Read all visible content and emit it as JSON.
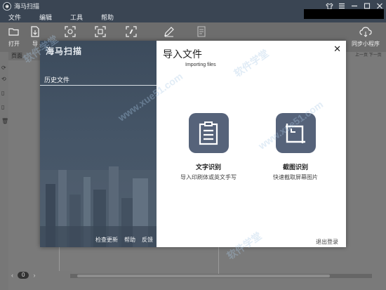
{
  "window": {
    "title": "海马扫描",
    "controls": [
      "shirt-icon",
      "menu-icon",
      "minimize-icon",
      "maximize-icon",
      "close-icon"
    ]
  },
  "menu": [
    "文件",
    "编辑",
    "工具",
    "帮助"
  ],
  "toolbar": {
    "open_label": "打开",
    "import_label": "导",
    "sync_label": "同步小程序"
  },
  "sidebar": {
    "page_header": "页面"
  },
  "right_panel": {
    "header": "上一页 下一页"
  },
  "bottom": {
    "page_number": "0"
  },
  "modal": {
    "brand": "海马扫描",
    "history_label": "历史文件",
    "footer_links": [
      "检查更新",
      "帮助",
      "反馈"
    ],
    "title": "导入文件",
    "subtitle": "Importing files",
    "close_symbol": "✕",
    "cards": [
      {
        "title": "文字识别",
        "desc": "导入印刷体或英文手写",
        "icon": "document-text-icon"
      },
      {
        "title": "截图识别",
        "desc": "快速截取屏幕图片",
        "icon": "screenshot-crop-icon"
      }
    ],
    "logout_label": "退出登录"
  },
  "watermark": {
    "lines": [
      "软件学堂",
      "www.xue51.com",
      "软件学堂",
      "www.xue51.com",
      "软件学堂"
    ]
  },
  "colors": {
    "titlebar": "#3a4553",
    "tile": "#56637a",
    "left_panel": "#455567"
  }
}
